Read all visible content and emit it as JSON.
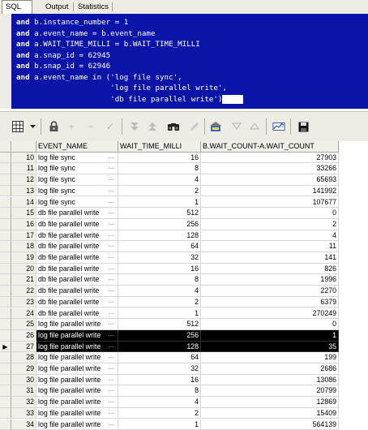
{
  "tabs": [
    {
      "label": "SQL",
      "active": true
    },
    {
      "label": "Output",
      "active": false
    },
    {
      "label": "Statistics",
      "active": false
    }
  ],
  "sql_lines": [
    {
      "kw": "and",
      "rest": " b.instance_number = 1"
    },
    {
      "kw": "and",
      "rest": " a.event_name = b.event_name"
    },
    {
      "kw": "and",
      "rest": " a.WAIT_TIME_MILLI = b.WAIT_TIME_MILLI"
    },
    {
      "kw": "and",
      "rest": " a.snap_id = 62945"
    },
    {
      "kw": "and",
      "rest": " b.snap_id = 62946"
    },
    {
      "kw": "and",
      "rest": " a.event_name in ('log file sync',"
    },
    {
      "kw": "",
      "rest": "                     'log file parallel write',"
    },
    {
      "kw": "",
      "rest": "                     'db file parallel write')"
    }
  ],
  "toolbar_icons": [
    "grid-icon",
    "dropdown-arrow-icon",
    "lock-icon",
    "add-record-icon",
    "delete-record-icon",
    "post-edit-icon",
    "sort-desc-icon",
    "sort-asc-icon",
    "find-icon",
    "clear-icon",
    "query-by-example-icon",
    "filter-icon",
    "previous-icon",
    "chart-icon",
    "save-icon"
  ],
  "grid": {
    "columns": [
      "EVENT_NAME",
      "WAIT_TIME_MILLI",
      "B.WAIT_COUNT-A.WAIT_COUNT"
    ],
    "rows": [
      {
        "n": "10",
        "event": "log file sync",
        "wait": "16",
        "count": "27903"
      },
      {
        "n": "11",
        "event": "log file sync",
        "wait": "8",
        "count": "33266"
      },
      {
        "n": "12",
        "event": "log file sync",
        "wait": "4",
        "count": "65693"
      },
      {
        "n": "13",
        "event": "log file sync",
        "wait": "2",
        "count": "141992"
      },
      {
        "n": "14",
        "event": "log file sync",
        "wait": "1",
        "count": "107677"
      },
      {
        "n": "15",
        "event": "db file parallel write",
        "wait": "512",
        "count": "0"
      },
      {
        "n": "16",
        "event": "db file parallel write",
        "wait": "256",
        "count": "2"
      },
      {
        "n": "17",
        "event": "db file parallel write",
        "wait": "128",
        "count": "4"
      },
      {
        "n": "18",
        "event": "db file parallel write",
        "wait": "64",
        "count": "11"
      },
      {
        "n": "19",
        "event": "db file parallel write",
        "wait": "32",
        "count": "141"
      },
      {
        "n": "20",
        "event": "db file parallel write",
        "wait": "16",
        "count": "826"
      },
      {
        "n": "21",
        "event": "db file parallel write",
        "wait": "8",
        "count": "1996"
      },
      {
        "n": "22",
        "event": "db file parallel write",
        "wait": "4",
        "count": "2270"
      },
      {
        "n": "23",
        "event": "db file parallel write",
        "wait": "2",
        "count": "6379"
      },
      {
        "n": "24",
        "event": "db file parallel write",
        "wait": "1",
        "count": "270249"
      },
      {
        "n": "25",
        "event": "log file parallel write",
        "wait": "512",
        "count": "0"
      },
      {
        "n": "26",
        "event": "log file parallel write",
        "wait": "256",
        "count": "1",
        "selected": true
      },
      {
        "n": "27",
        "event": "log file parallel write",
        "wait": "128",
        "count": "35",
        "selected": true,
        "current": true
      },
      {
        "n": "28",
        "event": "log file parallel write",
        "wait": "64",
        "count": "199"
      },
      {
        "n": "29",
        "event": "log file parallel write",
        "wait": "32",
        "count": "2686"
      },
      {
        "n": "30",
        "event": "log file parallel write",
        "wait": "16",
        "count": "13086"
      },
      {
        "n": "31",
        "event": "log file parallel write",
        "wait": "8",
        "count": "20799"
      },
      {
        "n": "32",
        "event": "log file parallel write",
        "wait": "4",
        "count": "12869"
      },
      {
        "n": "33",
        "event": "log file parallel write",
        "wait": "2",
        "count": "15409"
      },
      {
        "n": "34",
        "event": "log file parallel write",
        "wait": "1",
        "count": "564139"
      }
    ]
  },
  "current_row_marker": "▶"
}
